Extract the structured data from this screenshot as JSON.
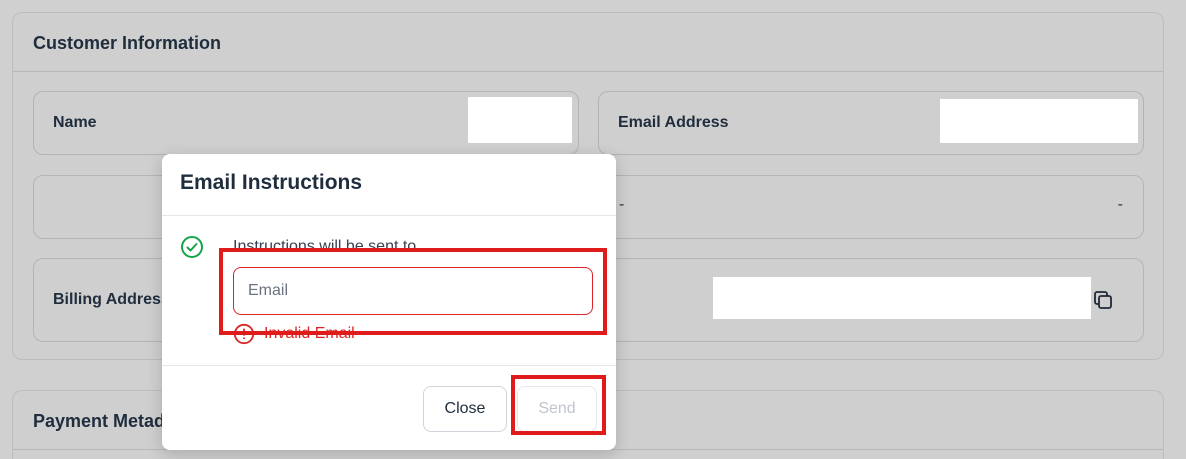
{
  "customer_card": {
    "title": "Customer Information",
    "fields": {
      "name_label": "Name",
      "email_label": "Email Address",
      "row2_dash_left": "-",
      "row2_dash_right": "-",
      "billing_label": "Billing Address"
    }
  },
  "payment_card": {
    "title": "Payment Metadata"
  },
  "modal": {
    "title": "Email Instructions",
    "instructions_text": "Instructions will be sent to",
    "email_placeholder": "Email",
    "error_text": "Invalid Email",
    "close_label": "Close",
    "send_label": "Send"
  },
  "colors": {
    "error": "#dc2626",
    "success": "#16a34a",
    "annotation": "#e01b1b",
    "overlay": "#d0d0d0"
  }
}
